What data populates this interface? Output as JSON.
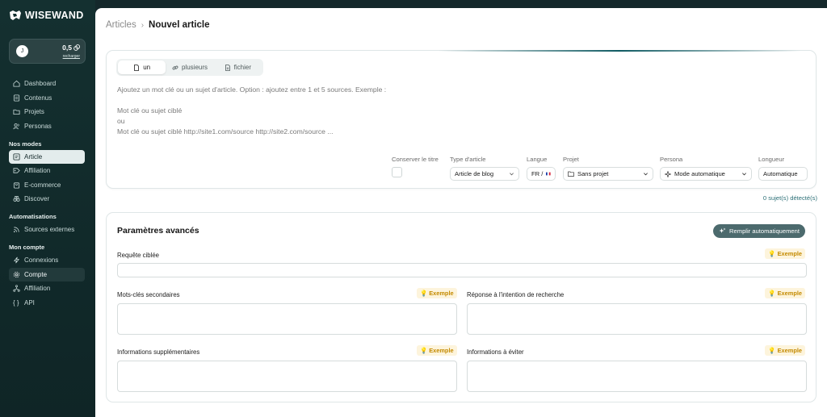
{
  "brand": {
    "name": "WISEWAND"
  },
  "account": {
    "avatar_initial": "J",
    "credits": "0,5",
    "recharge_label": "recharger"
  },
  "nav_main": [
    {
      "label": "Dashboard",
      "icon": "home-icon"
    },
    {
      "label": "Contenus",
      "icon": "document-icon"
    },
    {
      "label": "Projets",
      "icon": "folder-icon"
    },
    {
      "label": "Personas",
      "icon": "users-icon"
    }
  ],
  "sections": {
    "modes": "Nos modes",
    "automations": "Automatisations",
    "account": "Mon compte"
  },
  "nav_modes": [
    {
      "label": "Article",
      "icon": "article-icon",
      "state": "active"
    },
    {
      "label": "Affiliation",
      "icon": "tag-icon"
    },
    {
      "label": "E-commerce",
      "icon": "shop-icon"
    },
    {
      "label": "Discover",
      "icon": "binoculars-icon"
    }
  ],
  "nav_automations": [
    {
      "label": "Sources externes",
      "icon": "rss-icon"
    }
  ],
  "nav_account": [
    {
      "label": "Connexions",
      "icon": "bolt-icon"
    },
    {
      "label": "Compte",
      "icon": "gear-icon",
      "state": "selected"
    },
    {
      "label": "Affiliation",
      "icon": "network-icon"
    },
    {
      "label": "API",
      "icon": "braces-icon"
    }
  ],
  "breadcrumb": {
    "parent": "Articles",
    "separator": "›",
    "current": "Nouvel article"
  },
  "tabs": [
    {
      "label": "un",
      "icon": "file-icon",
      "active": true
    },
    {
      "label": "plusieurs",
      "icon": "link-icon",
      "active": false
    },
    {
      "label": "fichier",
      "icon": "file-text-icon",
      "active": false
    }
  ],
  "prompt": {
    "line1": "Ajoutez un mot clé ou un sujet d'article. Option : ajoutez entre 1 et 5 sources. Exemple :",
    "line2": "Mot clé ou sujet ciblé",
    "line3": "ou",
    "line4": "Mot clé ou sujet ciblé http://site1.com/source http://site2.com/source ..."
  },
  "options": {
    "keep_title": {
      "label": "Conserver le titre"
    },
    "article_type": {
      "label": "Type d'article",
      "value": "Article de blog"
    },
    "language": {
      "label": "Langue",
      "value": "FR /"
    },
    "project": {
      "label": "Projet",
      "value": "Sans projet"
    },
    "persona": {
      "label": "Persona",
      "value": "Mode automatique"
    },
    "length": {
      "label": "Longueur",
      "value": "Automatique"
    }
  },
  "detected": "0 sujet(s) détecté(s)",
  "advanced": {
    "title": "Paramètres avancés",
    "autofill_label": "Remplir automatiquement",
    "example_label": "Exemple",
    "fields": {
      "target_query": "Requête ciblée",
      "secondary_keywords": "Mots-clés secondaires",
      "search_intent": "Réponse à l'intention de recherche",
      "extra_info": "Informations supplémentaires",
      "avoid_info": "Informations à éviter"
    }
  },
  "colors": {
    "sidebar_bg": "#143030",
    "accent": "#4c6a6d",
    "example_bg": "#fdf4dc",
    "example_text": "#c48a00"
  }
}
